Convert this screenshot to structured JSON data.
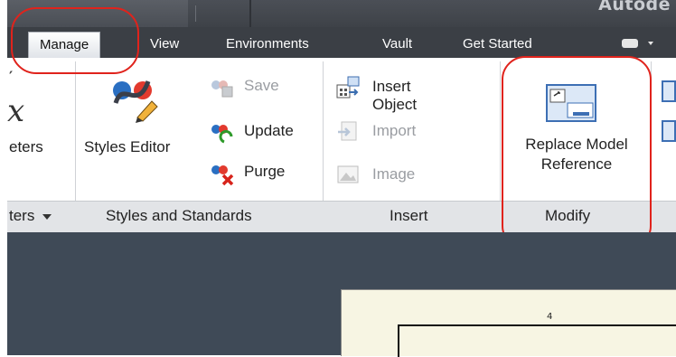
{
  "title_bar": {
    "app_title": "Autode"
  },
  "tabs": [
    {
      "label": "Manage",
      "active": true
    },
    {
      "label": "View"
    },
    {
      "label": "Environments"
    },
    {
      "label": "Vault"
    },
    {
      "label": "Get Started"
    }
  ],
  "ribbon": {
    "parameters": {
      "large_label": "eters",
      "icon_text": "x",
      "panel_label": "ters"
    },
    "styles": {
      "large_label": "Styles Editor",
      "small_buttons": [
        {
          "label": "Save",
          "enabled": false
        },
        {
          "label": "Update",
          "enabled": true
        },
        {
          "label": "Purge",
          "enabled": true
        }
      ],
      "panel_label": "Styles and Standards"
    },
    "insert": {
      "small_buttons": [
        {
          "label": "Insert Object",
          "enabled": true
        },
        {
          "label": "Import",
          "enabled": false
        },
        {
          "label": "Image",
          "enabled": false
        }
      ],
      "panel_label": "Insert"
    },
    "modify": {
      "large_label_line1": "Replace Model",
      "large_label_line2": "Reference",
      "panel_label": "Modify"
    }
  },
  "drawing": {
    "sheet_number": "4"
  },
  "colors": {
    "highlight": "#e0231c",
    "tab_bar": "#3b3f45",
    "canvas": "#3f4a57",
    "sheet": "#f7f5e3"
  }
}
